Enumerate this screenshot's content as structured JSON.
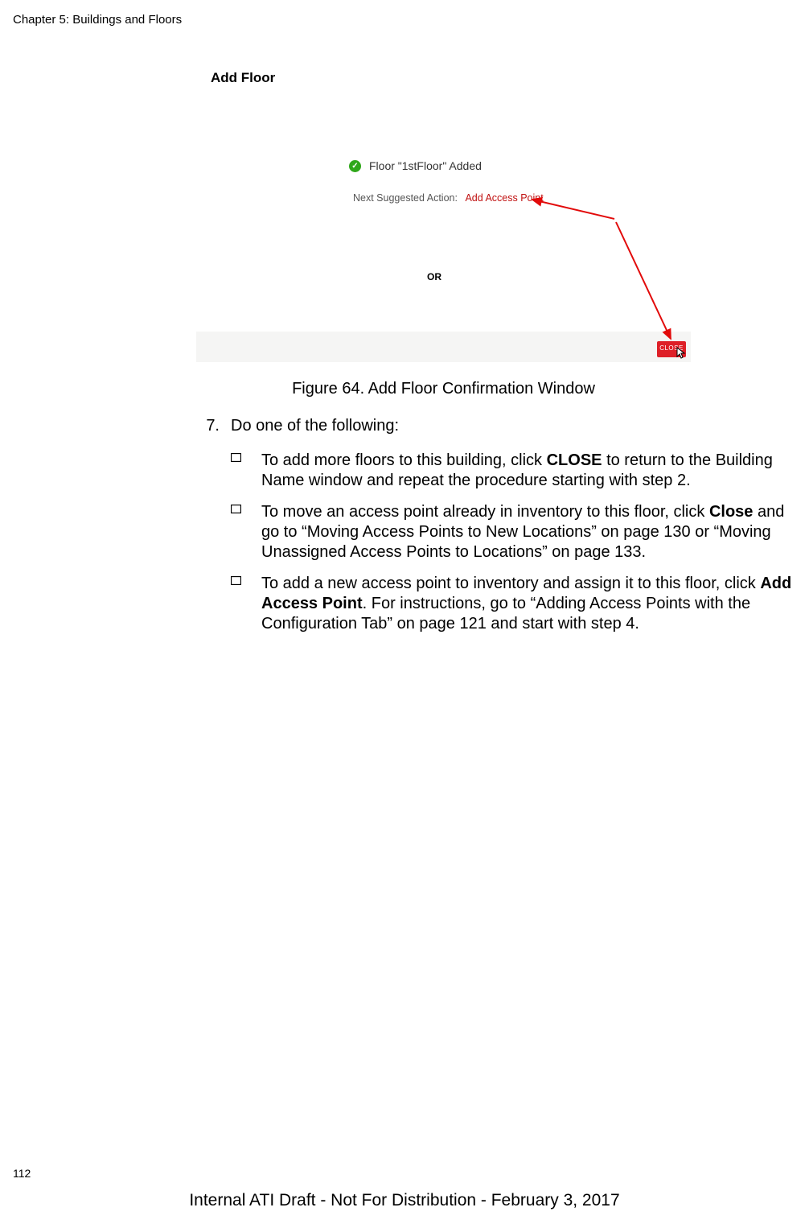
{
  "header": {
    "chapter": "Chapter 5: Buildings and Floors"
  },
  "figure": {
    "dialogTitle": "Add Floor",
    "addedMsg": "Floor \"1stFloor\" Added",
    "suggestedLabel": "Next Suggested Action:",
    "suggestedLink": "Add Access Point",
    "orText": "OR",
    "closeLabel": "CLOSE",
    "caption": "Figure 64. Add Floor Confirmation Window"
  },
  "step": {
    "num": "7.",
    "text": "Do one of the following:"
  },
  "bullets": [
    {
      "pre": "To add more floors to this building, click ",
      "bold": "CLOSE",
      "post": " to return to the Building Name window and repeat the procedure starting with step 2."
    },
    {
      "pre": "To move an access point already in inventory to this floor, click ",
      "bold": "Close",
      "post": " and go to “Moving Access Points to New Locations” on page 130 or “Moving Unassigned Access Points to Locations” on page 133."
    },
    {
      "pre": "To add a new access point to inventory and assign it to this floor, click ",
      "bold": "Add Access Point",
      "post": ". For instructions, go to “Adding Access Points with the Configuration Tab” on page 121 and start with step 4."
    }
  ],
  "footer": {
    "pageNum": "112",
    "draft": "Internal ATI Draft - Not For Distribution - February 3, 2017"
  }
}
